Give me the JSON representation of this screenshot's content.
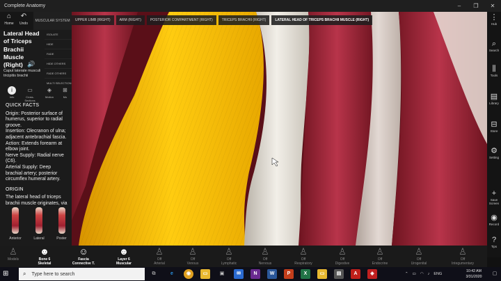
{
  "window": {
    "title": "Complete Anatomy",
    "controls": [
      "–",
      "❐",
      "✕"
    ]
  },
  "toolbar": {
    "home_label": "Home",
    "undo_label": "Undo",
    "muscular_system_label": "MUSCULAR SYSTEM"
  },
  "structure": {
    "name": "Lateral Head of Triceps Brachii Muscle (Right)",
    "name_lines": [
      "Lateral Head",
      "of Triceps",
      "Brachii",
      "Muscle",
      "(Right)"
    ],
    "latin": "Caput laterale musculi tricipitis brachii"
  },
  "side_menu": [
    "ISOLATE",
    "HIDE",
    "FADE",
    "HIDE OTHERS",
    "FADE OTHERS",
    "MULTI SELECTION"
  ],
  "tabs": [
    {
      "label": "Info",
      "icon": "info-icon",
      "active": true
    },
    {
      "label": "Cross-Sections",
      "icon": "cross-section-icon",
      "active": false
    },
    {
      "label": "Motion",
      "icon": "motion-icon",
      "active": false
    },
    {
      "label": "Mo",
      "icon": "more-icon",
      "active": false
    }
  ],
  "quick_facts": {
    "heading": "QUICK FACTS",
    "origin": "Origin: Posterior surface of humerus, superior to radial groove.",
    "insertion": "Insertion: Olecranon of ulna; adjacent antebrachial fascia.",
    "action": "Action: Extends forearm at elbow joint.",
    "nerve": "Nerve Supply: Radial nerve (C6).",
    "arterial": "Arterial Supply: Deep brachial artery; posterior circumflex humeral artery."
  },
  "origin_section": {
    "heading": "ORIGIN",
    "text": "The lateral head of triceps brachii muscle originates, via"
  },
  "thumbnails": [
    "Anterior",
    "Lateral",
    "Poster"
  ],
  "breadcrumbs": [
    {
      "label": "UPPER LIMB (RIGHT)",
      "active": false
    },
    {
      "label": "ARM (RIGHT)",
      "active": false
    },
    {
      "label": "POSTERIOR COMPARTMENT (RIGHT)",
      "active": false
    },
    {
      "label": "TRICEPS BRACHII (RIGHT)",
      "active": false
    },
    {
      "label": "LATERAL HEAD OF TRICEPS BRACHII MUSCLE (RIGHT)",
      "active": true
    }
  ],
  "right_rail": [
    {
      "label": "Hub",
      "icon": "hub-icon"
    },
    {
      "label": "Search",
      "icon": "search-icon"
    },
    {
      "label": "Tools",
      "icon": "tools-icon"
    },
    {
      "label": "Library",
      "icon": "library-icon"
    },
    {
      "label": "Store",
      "icon": "store-icon"
    },
    {
      "label": "Setting",
      "icon": "gear-icon"
    },
    {
      "label": "Save Screen",
      "icon": "save-screen-icon"
    },
    {
      "label": "Record",
      "icon": "record-icon"
    },
    {
      "label": "Tips",
      "icon": "tips-icon"
    }
  ],
  "layers": [
    {
      "top": "",
      "label": "Models",
      "on": false
    },
    {
      "top": "Bone 6",
      "label": "Skeletal",
      "on": true
    },
    {
      "top": "Fascia",
      "label": "Connective T.",
      "on": true
    },
    {
      "top": "Layer 6",
      "label": "Muscular",
      "on": true
    },
    {
      "top": "Off",
      "label": "Arterial",
      "on": false
    },
    {
      "top": "Off",
      "label": "Venous",
      "on": false
    },
    {
      "top": "Off",
      "label": "Lymphatic",
      "on": false
    },
    {
      "top": "Off",
      "label": "Nervous",
      "on": false
    },
    {
      "top": "Off",
      "label": "Respiratory",
      "on": false
    },
    {
      "top": "Off",
      "label": "Digestive",
      "on": false
    },
    {
      "top": "Off",
      "label": "Endocrine",
      "on": false
    },
    {
      "top": "Off",
      "label": "Urogenital",
      "on": false
    },
    {
      "top": "Off",
      "label": "Integumentary",
      "on": false
    }
  ],
  "taskbar": {
    "search_placeholder": "Type here to search",
    "language": "ENG",
    "time": "10:42 AM",
    "date": "3/31/2020"
  },
  "colors": {
    "muscle_red": "#a8283c",
    "fascia_yellow": "#f0b800",
    "bone_white": "#e8e4dc"
  }
}
